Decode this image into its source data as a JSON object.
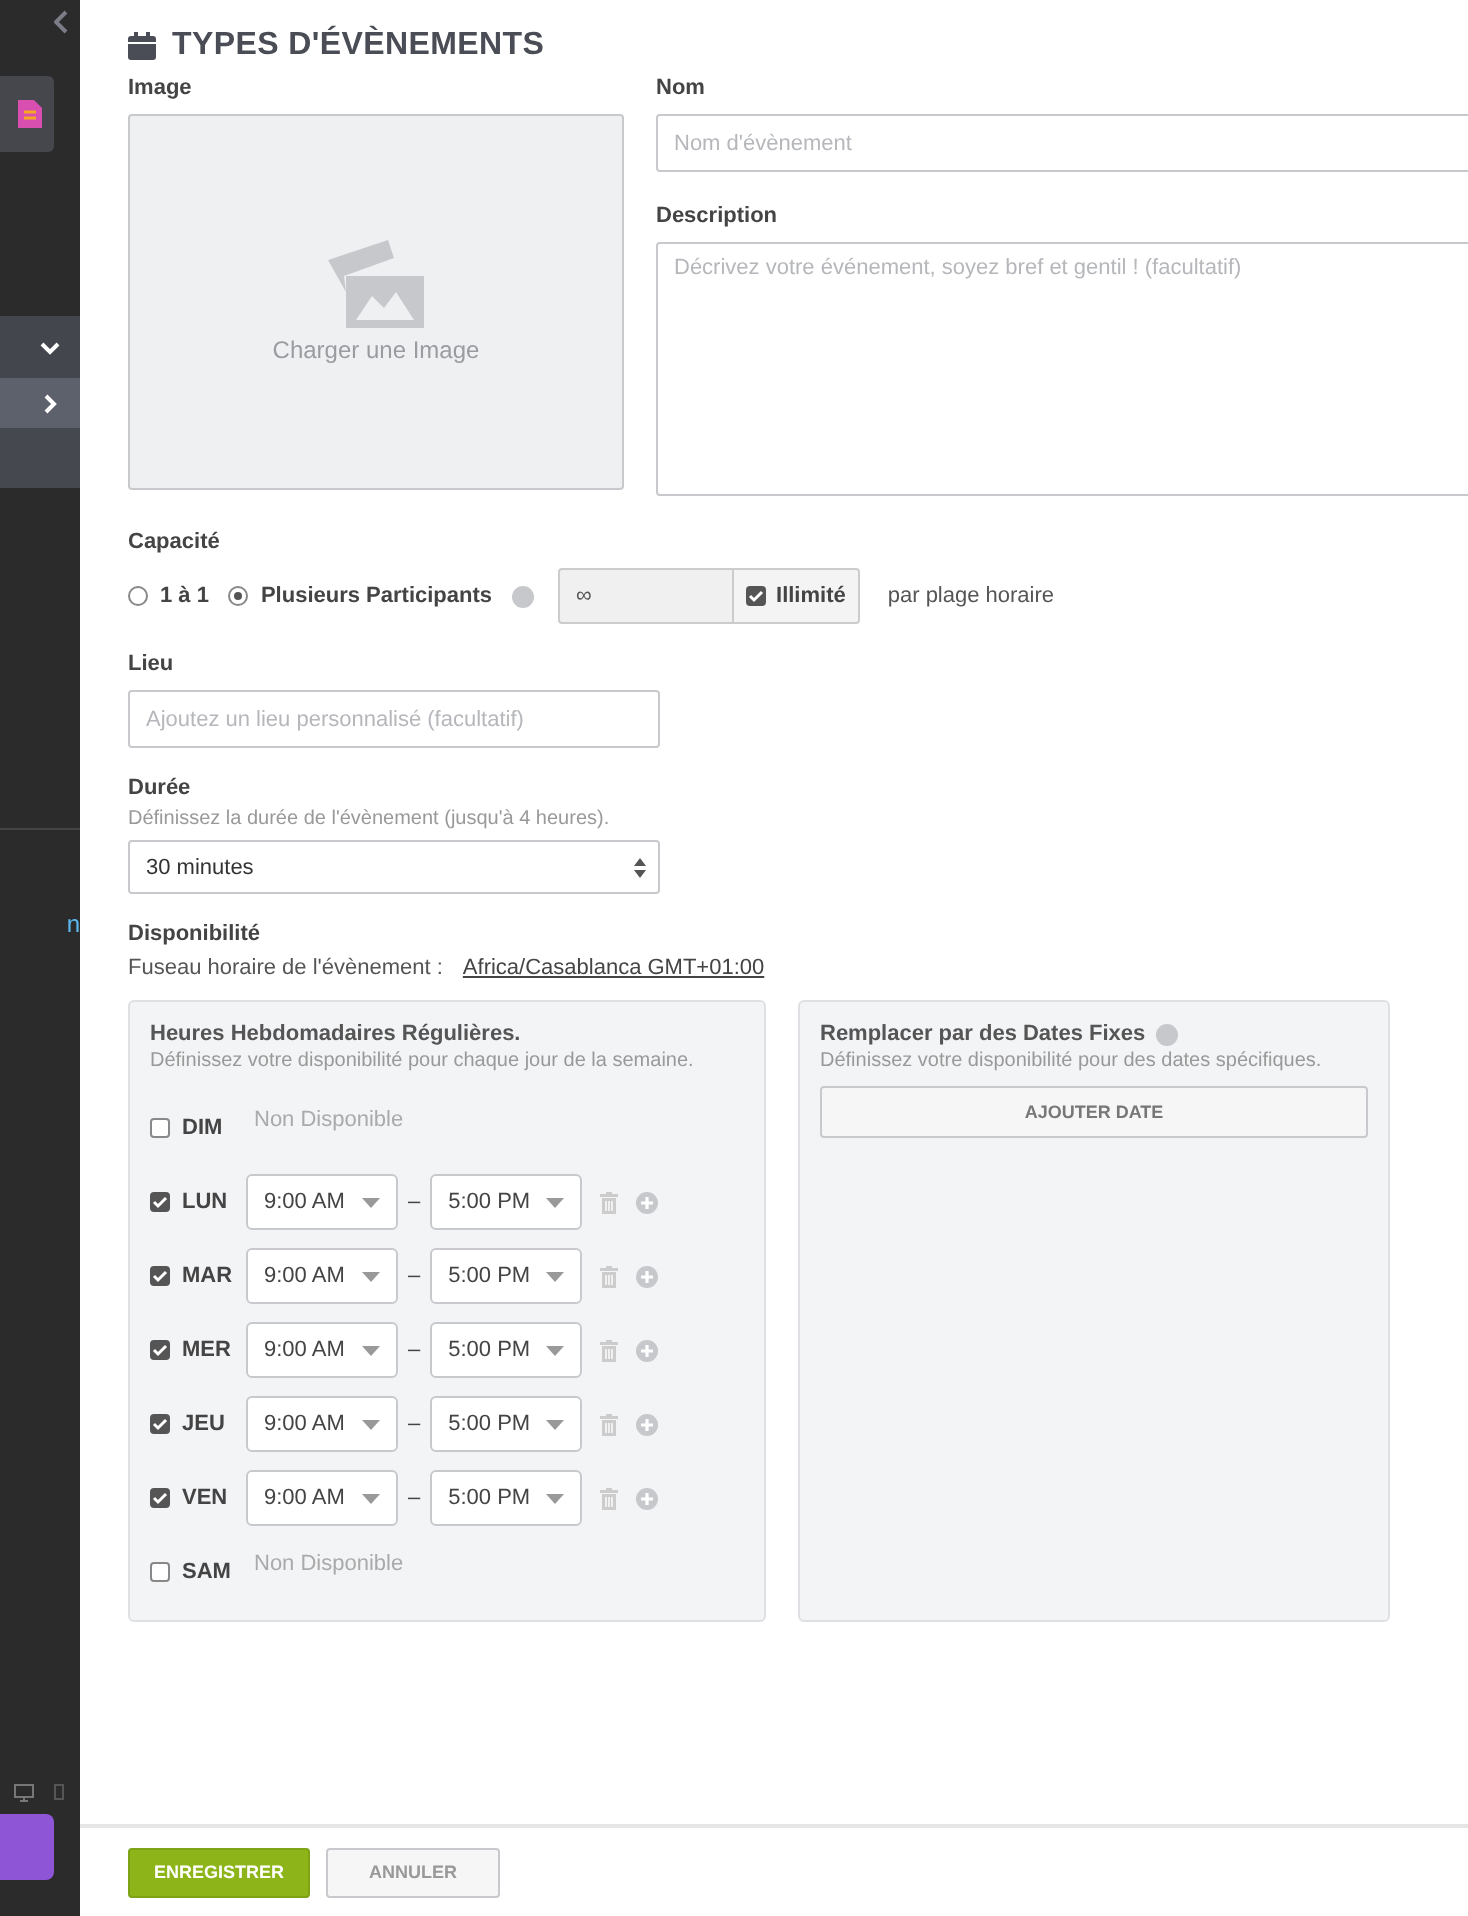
{
  "sidebar": {
    "rows": [
      {
        "expanded": true,
        "selected": false
      },
      {
        "expanded": false,
        "selected": true
      }
    ],
    "link_fragment": "n"
  },
  "title": "TYPES D'ÉVÈNEMENTS",
  "image": {
    "label": "Image",
    "upload_text": "Charger une Image"
  },
  "name": {
    "label": "Nom",
    "placeholder": "Nom d'évènement"
  },
  "description": {
    "label": "Description",
    "placeholder": "Décrivez votre événement, soyez bref et gentil ! (facultatif)"
  },
  "capacity": {
    "label": "Capacité",
    "options": [
      {
        "label": "1 à 1",
        "selected": false
      },
      {
        "label": "Plusieurs Participants",
        "selected": true
      }
    ],
    "count_value": "∞",
    "unlimited": {
      "label": "Illimité",
      "checked": true
    },
    "suffix": "par plage horaire"
  },
  "location": {
    "label": "Lieu",
    "placeholder": "Ajoutez un lieu personnalisé (facultatif)"
  },
  "duration": {
    "label": "Durée",
    "hint": "Définissez la durée de l'évènement (jusqu'à 4 heures).",
    "value": "30 minutes"
  },
  "availability": {
    "label": "Disponibilité",
    "timezone_label": "Fuseau horaire de l'évènement :",
    "timezone": "Africa/Casablanca GMT+01:00"
  },
  "weekly": {
    "title": "Heures Hebdomadaires Régulières.",
    "subtitle": "Définissez votre disponibilité pour chaque jour de la semaine.",
    "days": [
      {
        "label": "DIM",
        "checked": false,
        "note": "Non Disponible"
      },
      {
        "label": "LUN",
        "checked": true,
        "start": "9:00 AM",
        "dash": "–",
        "end": "5:00 PM"
      },
      {
        "label": "MAR",
        "checked": true,
        "start": "9:00 AM",
        "dash": "–",
        "end": "5:00 PM"
      },
      {
        "label": "MER",
        "checked": true,
        "start": "9:00 AM",
        "dash": "–",
        "end": "5:00 PM"
      },
      {
        "label": "JEU",
        "checked": true,
        "start": "9:00 AM",
        "dash": "–",
        "end": "5:00 PM"
      },
      {
        "label": "VEN",
        "checked": true,
        "start": "9:00 AM",
        "dash": "–",
        "end": "5:00 PM"
      },
      {
        "label": "SAM",
        "checked": false,
        "note": "Non Disponible"
      }
    ]
  },
  "fixed_dates": {
    "title": "Remplacer par des Dates Fixes",
    "subtitle": "Définissez votre disponibilité pour des dates spécifiques.",
    "button": "AJOUTER DATE"
  },
  "footer": {
    "save": "ENREGISTRER",
    "cancel": "ANNULER"
  }
}
